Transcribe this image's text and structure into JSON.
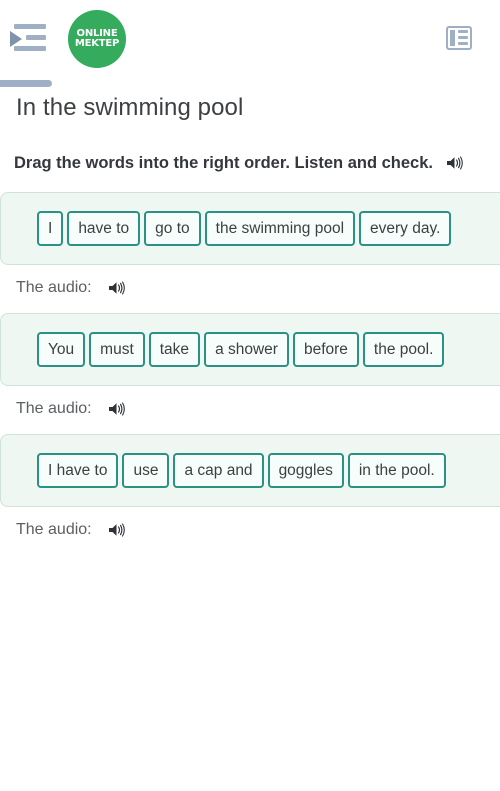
{
  "header": {
    "menu_icon": "menu-indent-icon",
    "logo": {
      "line1": "ONLINE",
      "line2": "MEKTEP",
      "color": "#35ab5e"
    },
    "list_icon": "list-view-icon"
  },
  "page": {
    "title": "In the swimming pool",
    "instruction": "Drag the words into the right order. Listen and check.",
    "audio_label": "The audio:"
  },
  "exercises": [
    {
      "id": "exercise-1",
      "chips": [
        "I",
        "have to",
        "go to",
        "the swimming pool",
        "every day."
      ],
      "audio_label": "The audio:"
    },
    {
      "id": "exercise-2",
      "chips": [
        "You",
        "must",
        "take",
        "a shower",
        "before",
        "the pool."
      ],
      "audio_label": "The audio:"
    },
    {
      "id": "exercise-3",
      "chips": [
        "I have to",
        "use",
        "a cap and",
        "goggles",
        "in the pool."
      ],
      "audio_label": "The audio:"
    }
  ],
  "colors": {
    "accent_green": "#35ab5e",
    "chip_border": "#2b9184",
    "box_background": "#eef7f1",
    "icon_gray": "#9fb0c4"
  }
}
